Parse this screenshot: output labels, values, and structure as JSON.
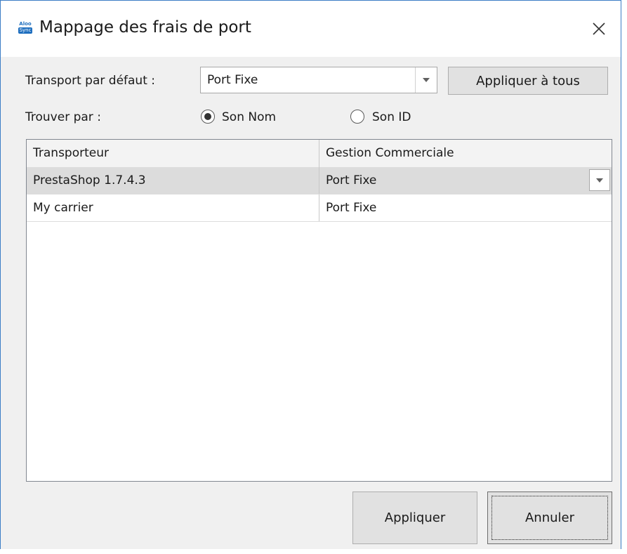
{
  "window": {
    "title": "Mappage des frais de port",
    "logo_line1": "Aloo",
    "logo_line2": "Sync"
  },
  "default_transport": {
    "label": "Transport par défaut :",
    "value": "Port Fixe",
    "apply_all_label": "Appliquer à tous"
  },
  "find_by": {
    "label": "Trouver par :",
    "options": [
      {
        "label": "Son Nom",
        "checked": true
      },
      {
        "label": "Son ID",
        "checked": false
      }
    ]
  },
  "table": {
    "columns": [
      "Transporteur",
      "Gestion Commerciale"
    ],
    "rows": [
      {
        "carrier": "PrestaShop 1.7.4.3",
        "mapping": "Port Fixe",
        "selected": true
      },
      {
        "carrier": "My carrier",
        "mapping": "Port Fixe",
        "selected": false
      }
    ]
  },
  "footer": {
    "apply_label": "Appliquer",
    "cancel_label": "Annuler"
  },
  "icons": {
    "close": "close-icon",
    "dropdown": "chevron-down-icon",
    "logo": "app-logo-icon"
  },
  "colors": {
    "window_border": "#3c7ec6",
    "selected_row": "#dcdcdc",
    "button_face": "#e1e1e1"
  }
}
